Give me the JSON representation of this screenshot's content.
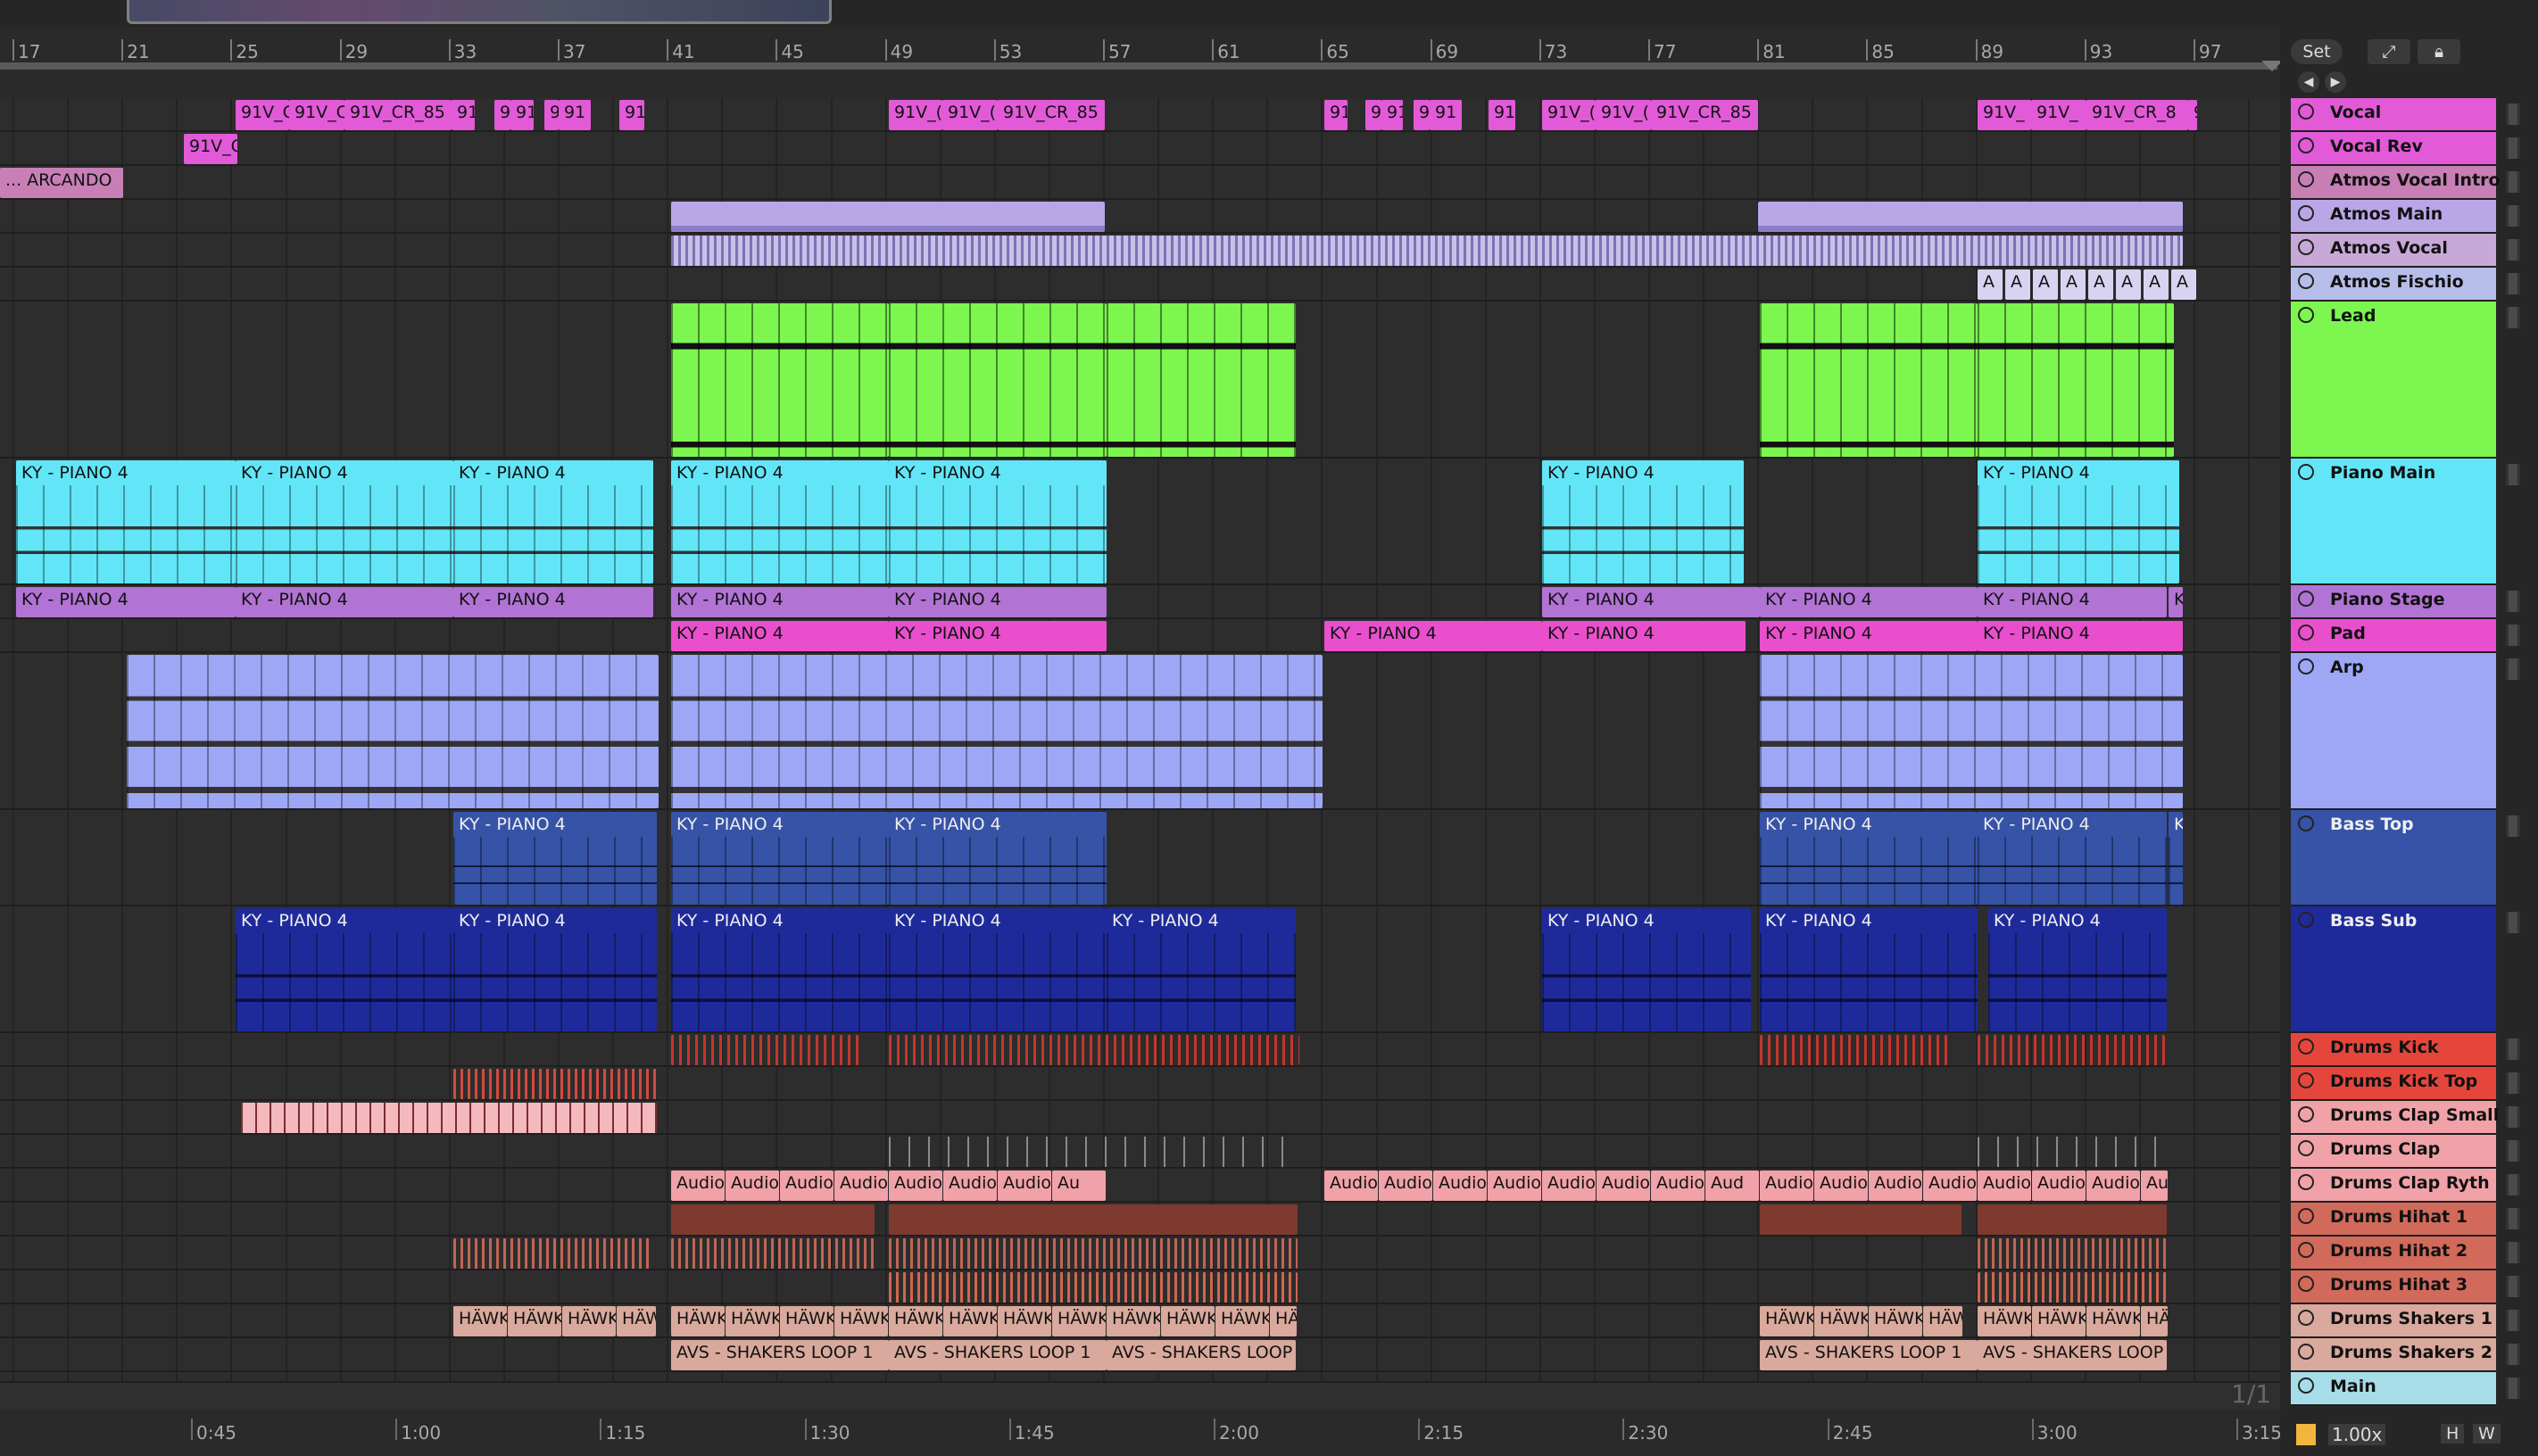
{
  "ruler": {
    "bars": [
      "17",
      "21",
      "25",
      "29",
      "33",
      "37",
      "41",
      "45",
      "49",
      "53",
      "57",
      "61",
      "65",
      "69",
      "73",
      "77",
      "81",
      "85",
      "89",
      "93",
      "97"
    ]
  },
  "time_ruler": {
    "labels": [
      "0:45",
      "1:00",
      "1:15",
      "1:30",
      "1:45",
      "2:00",
      "2:15",
      "2:30",
      "2:45",
      "3:00",
      "3:15"
    ]
  },
  "header": {
    "set_label": "Set",
    "expand_icon": "expand-icon",
    "lock_icon": "lock-icon",
    "back_icon": "arrow-left-icon",
    "forward_icon": "arrow-right-icon"
  },
  "page_indicator": "1/1",
  "footer": {
    "zoom": "1.00x",
    "h_label": "H",
    "w_label": "W"
  },
  "colors": {
    "vocal": "#e25ad8",
    "pink": "#e94fcd",
    "atmos": "#b9a6e6",
    "lead": "#7df64f",
    "piano": "#62e6f7",
    "stage": "#b173d4",
    "arp": "#9ea6f6",
    "basstop": "#3653a7",
    "basssub": "#1f2a9a",
    "kick": "#e5463c",
    "clap": "#f0a2a8",
    "hihat": "#d16a5a",
    "shaker": "#d8a99c"
  },
  "tracks": [
    {
      "name": "Vocal",
      "icon": "play-icon"
    },
    {
      "name": "Vocal Rev",
      "icon": "play-icon"
    },
    {
      "name": "Atmos Vocal Intro",
      "icon": "play-icon"
    },
    {
      "name": "Atmos Main",
      "icon": "list-icon"
    },
    {
      "name": "Atmos Vocal",
      "icon": "play-icon"
    },
    {
      "name": "Atmos Fischio",
      "icon": "play-icon"
    },
    {
      "name": "Lead",
      "icon": "fold-icon"
    },
    {
      "name": "Piano Main",
      "icon": "fold-icon"
    },
    {
      "name": "Piano Stage",
      "icon": "play-icon"
    },
    {
      "name": "Pad",
      "icon": "play-icon"
    },
    {
      "name": "Arp",
      "icon": "fold-icon"
    },
    {
      "name": "Bass Top",
      "icon": "fold-icon"
    },
    {
      "name": "Bass Sub",
      "icon": "fold-icon"
    },
    {
      "name": "Drums Kick",
      "icon": "play-icon"
    },
    {
      "name": "Drums Kick Top",
      "icon": "play-icon"
    },
    {
      "name": "Drums Clap Small",
      "icon": "play-icon"
    },
    {
      "name": "Drums Clap",
      "icon": "play-icon"
    },
    {
      "name": "Drums Clap Ryth",
      "icon": "play-icon"
    },
    {
      "name": "Drums Hihat 1",
      "icon": "play-icon"
    },
    {
      "name": "Drums Hihat 2",
      "icon": "play-icon"
    },
    {
      "name": "Drums Hihat 3",
      "icon": "play-icon"
    },
    {
      "name": "Drums Shakers 1",
      "icon": "play-icon"
    },
    {
      "name": "Drums Shakers 2",
      "icon": "play-icon"
    },
    {
      "name": "Main",
      "icon": "play-icon"
    }
  ],
  "clip_names": {
    "v1": "91V_C",
    "v2": "91V_C",
    "v3": "91V_CR_85",
    "v4": "91",
    "v5": "9",
    "v6": "91",
    "v7": "9",
    "v8": "91",
    "v9": "91",
    "v10": "91V_(",
    "v11": "91V_(",
    "v12": "91V_CR_85",
    "v13": "91",
    "v14": "9",
    "v15": "91",
    "v16": "9",
    "v17": "91",
    "v18": "91",
    "v19": "91V_(",
    "v20": "91V_(",
    "v21": "91V_CR_85",
    "v22": "91V_",
    "v23": "91V_",
    "v24": "91V_CR_8",
    "v25": "9",
    "vr1": "91V_C",
    "ai1": "... ARCANDO",
    "ky": "KY - PIANO 4",
    "ky_short": "KY - PIANO",
    "ky_h": "K",
    "audio": "Audio",
    "aud": "Aud",
    "au": "Au",
    "hawk": "HÄWK",
    "haw": "HÄW",
    "ha": "HÄ",
    "shaker1": "AVS - SHAKERS LOOP 1",
    "shaker_cut": "AVS - SHAKERS LOOP",
    "fis": "A"
  }
}
